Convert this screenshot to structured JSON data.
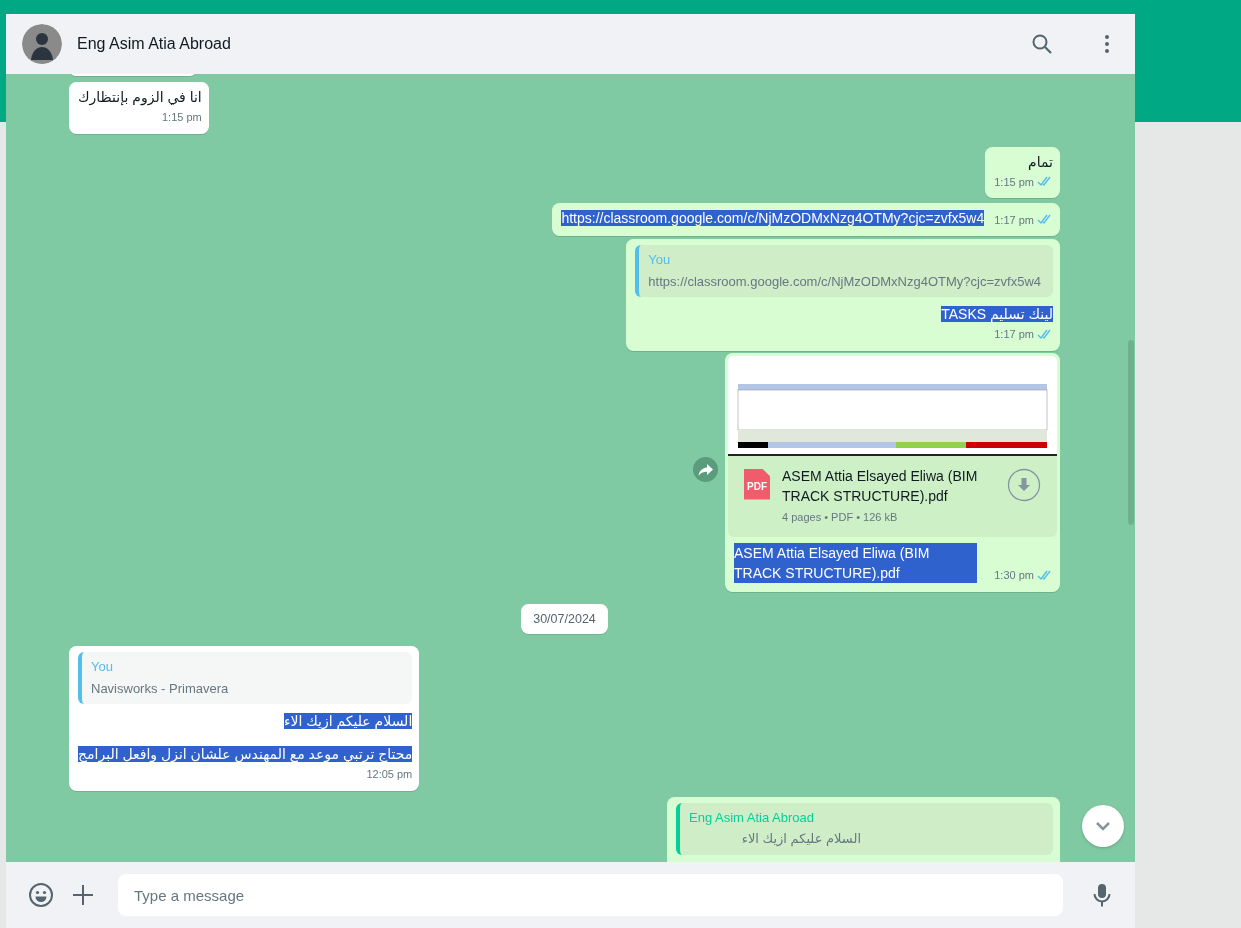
{
  "header": {
    "contact_name": "Eng Asim Atia Abroad"
  },
  "messages": [
    {
      "kind": "stub",
      "outgoing": false
    },
    {
      "kind": "text",
      "outgoing": false,
      "text": "انا في الزوم بإنتظارك",
      "time": "1:15 pm",
      "text_selected": false
    },
    {
      "kind": "text",
      "outgoing": true,
      "text": "تمام",
      "time": "1:15 pm",
      "read": true,
      "text_selected": false
    },
    {
      "kind": "text",
      "outgoing": true,
      "text": "https://classroom.google.com/c/NjMzODMxNzg4OTMy?cjc=zvfx5w4",
      "time": "1:17 pm",
      "read": true,
      "text_selected": true
    },
    {
      "kind": "reply",
      "outgoing": true,
      "quote": {
        "author": "You",
        "color": "#53bdeb",
        "lines": [
          "https://classroom.google.com/c/NjMzODMxNzg4OTMy?cjc=zvfx5w4"
        ]
      },
      "lines": [
        "لينك تسليم TASKS"
      ],
      "time": "1:17 pm",
      "read": true,
      "text_selected": true
    },
    {
      "kind": "document",
      "outgoing": true,
      "file_type": "PDF",
      "file_name": "ASEM Attia Elsayed Eliwa (BIM TRACK STRUCTURE).pdf",
      "file_meta": "4 pages • PDF • 126 kB",
      "caption": "ASEM Attia Elsayed Eliwa (BIM TRACK STRUCTURE).pdf",
      "time": "1:30 pm",
      "read": true,
      "text_selected": true
    },
    {
      "kind": "date",
      "text": "30/07/2024"
    },
    {
      "kind": "reply",
      "outgoing": false,
      "quote": {
        "author": "You",
        "color": "#53bdeb",
        "lines": [
          "Navisworks - Primavera"
        ]
      },
      "lines": [
        "السلام عليكم ازيك الاء",
        "محتاج ترتبي موعد مع المهندس علشان انزل وافعل البرامج"
      ],
      "time": "12:05 pm",
      "text_selected": true
    },
    {
      "kind": "reply",
      "outgoing": true,
      "quote": {
        "author": "Eng Asim Atia Abroad",
        "color": "#06cf9c",
        "lines": [
          "السلام عليكم ازيك الاء"
        ]
      }
    }
  ],
  "composer": {
    "placeholder": "Type a message"
  }
}
